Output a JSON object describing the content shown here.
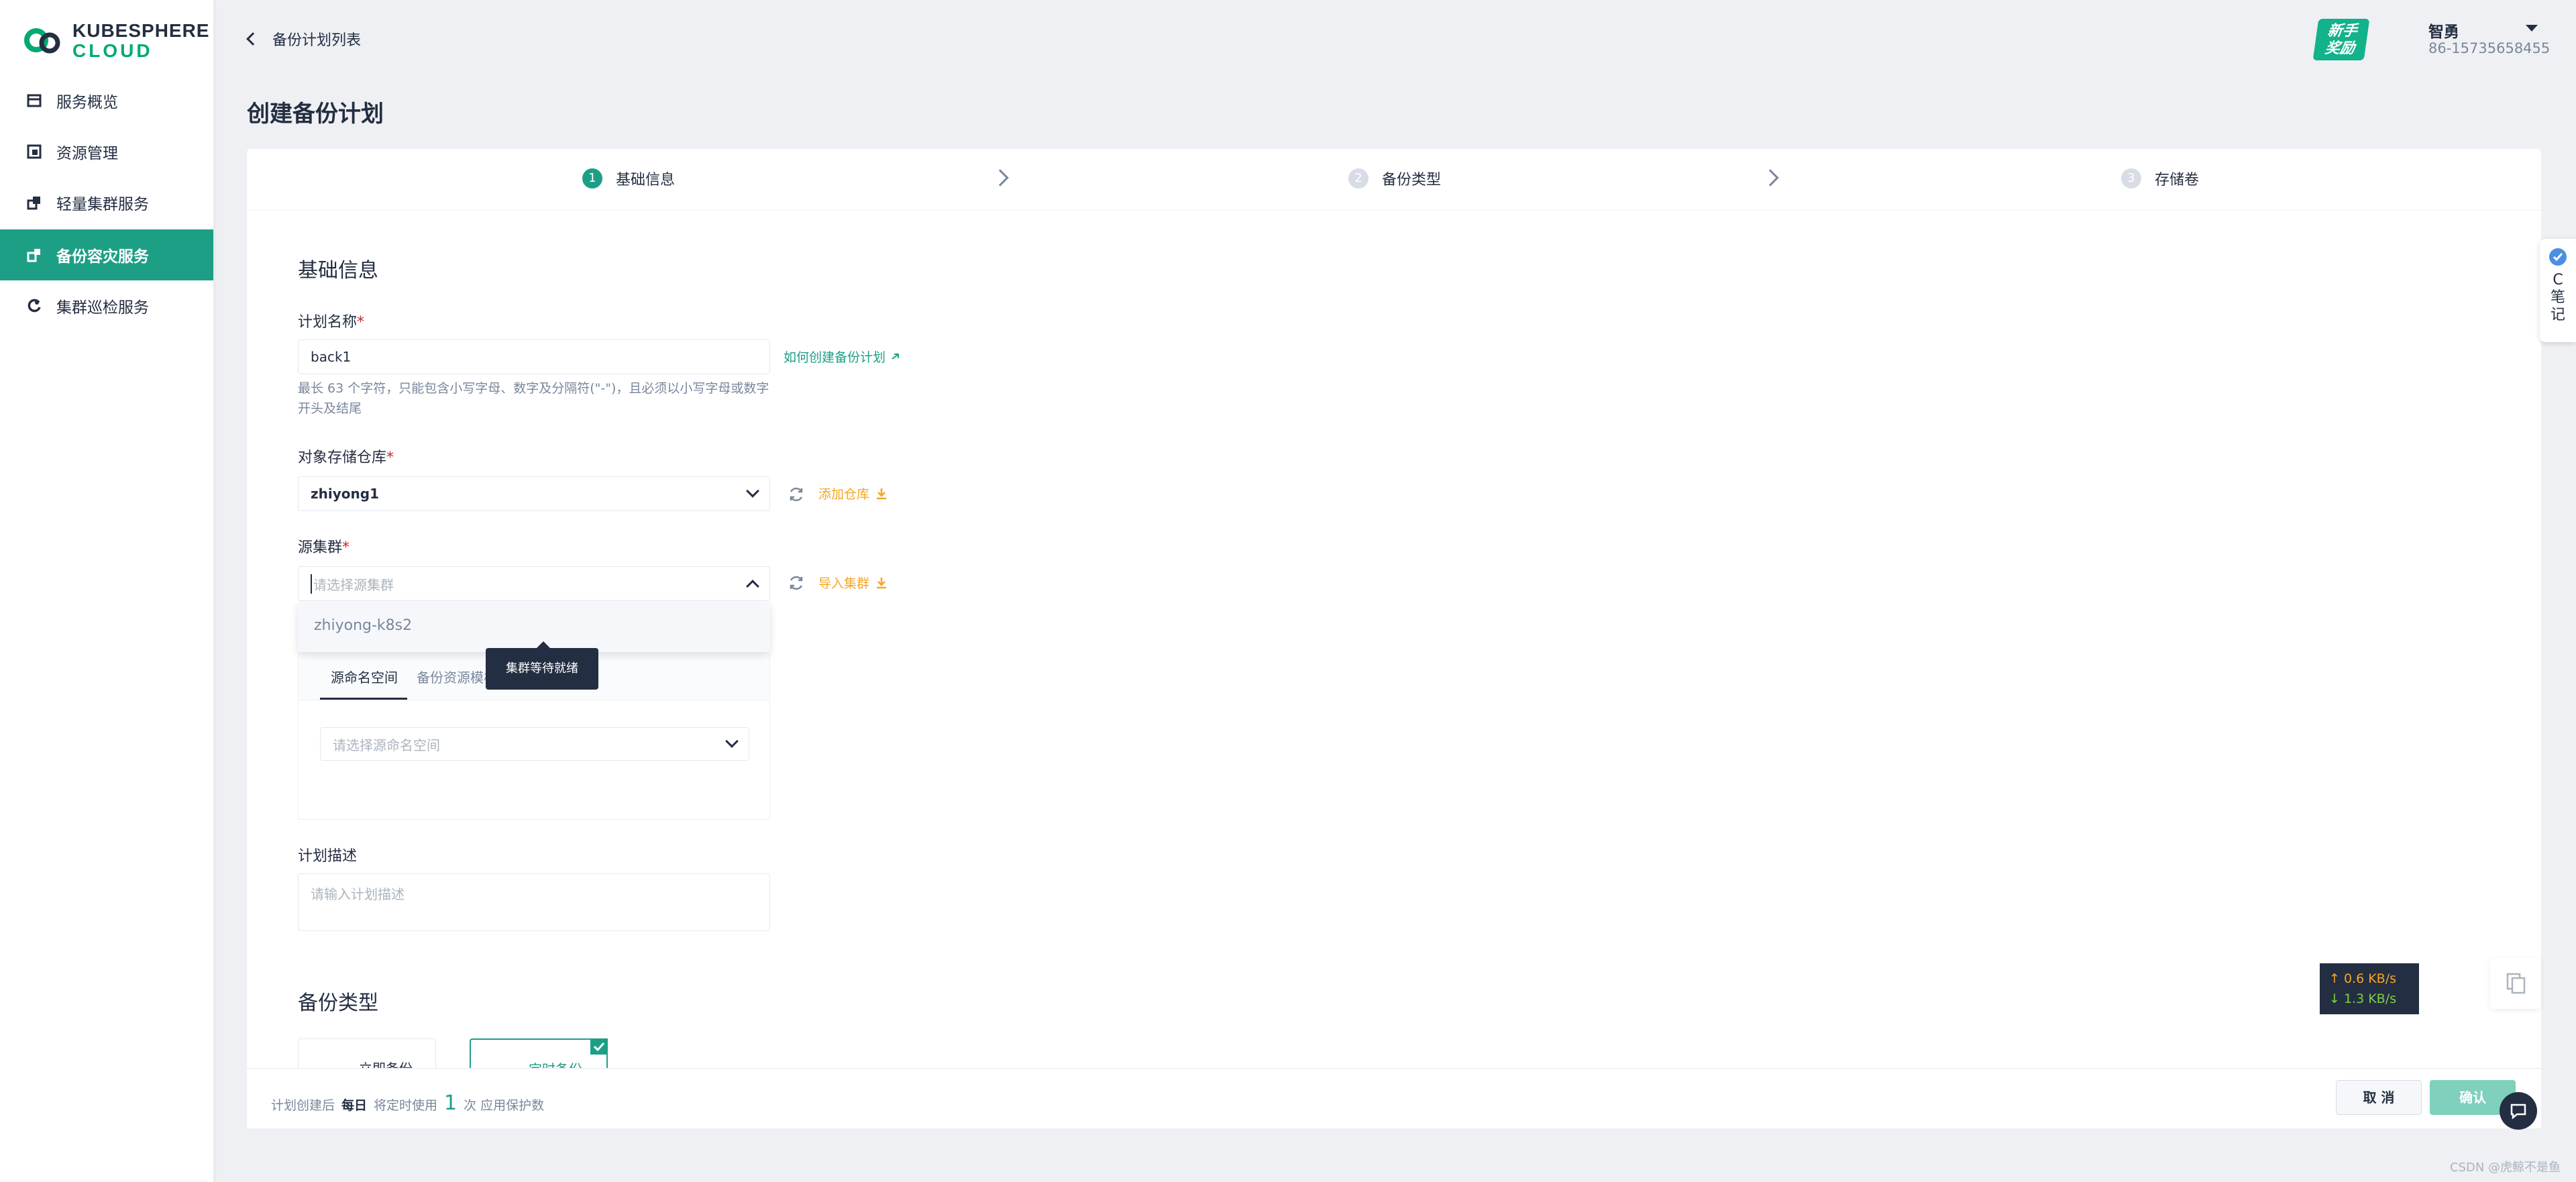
{
  "app": {
    "logo_line1": "KUBESPHERE",
    "logo_line2": "CLOUD"
  },
  "sidebar": {
    "items": [
      {
        "label": "服务概览",
        "icon": "overview-icon",
        "active": false
      },
      {
        "label": "资源管理",
        "icon": "resource-icon",
        "active": false
      },
      {
        "label": "轻量集群服务",
        "icon": "cluster-icon",
        "active": false
      },
      {
        "label": "备份容灾服务",
        "icon": "backup-icon",
        "active": true
      },
      {
        "label": "集群巡检服务",
        "icon": "inspection-icon",
        "active": false
      }
    ]
  },
  "header": {
    "back_label": "备份计划列表",
    "reward_line1": "新手",
    "reward_line2": "奖励",
    "user_name": "智勇",
    "user_phone": "86-15735658455"
  },
  "page": {
    "title": "创建备份计划"
  },
  "steps": [
    {
      "num": "1",
      "label": "基础信息"
    },
    {
      "num": "2",
      "label": "备份类型"
    },
    {
      "num": "3",
      "label": "存储卷"
    }
  ],
  "form": {
    "section_title": "基础信息",
    "plan_name": {
      "label": "计划名称",
      "required": "*",
      "value": "back1",
      "help": "最长 63 个字符，只能包含小写字母、数字及分隔符(\"-\")，且必须以小写字母或数字开头及结尾",
      "link": "如何创建备份计划"
    },
    "repo": {
      "label": "对象存储仓库",
      "required": "*",
      "value": "zhiyong1",
      "add_link": "添加仓库"
    },
    "source_cluster": {
      "label": "源集群",
      "required": "*",
      "placeholder": "请选择源集群",
      "import_link": "导入集群",
      "options": [
        "zhiyong-k8s2"
      ],
      "tooltip": "集群等待就绪"
    },
    "tabs": [
      {
        "label": "源命名空间"
      },
      {
        "label": "备份资源模板"
      }
    ],
    "namespace_placeholder": "请选择源命名空间",
    "description": {
      "label": "计划描述",
      "placeholder": "请输入计划描述"
    }
  },
  "backup_type": {
    "section_title": "备份类型",
    "options": [
      "立即备份",
      "定时备份"
    ]
  },
  "footer": {
    "text1": "计划创建后",
    "bold": "每日",
    "text2": "将定时使用",
    "count": "1",
    "text3": "次 应用保护数",
    "cancel": "取 消",
    "confirm": "确认"
  },
  "overlay": {
    "upload_speed": "↑ 0.6 KB/s",
    "download_speed": "↓ 1.3 KB/s",
    "note_line1": "C",
    "note_line2": "笔",
    "note_line3": "记",
    "watermark": "CSDN @虎鲸不是鱼"
  },
  "colors": {
    "accent": "#1d9f86",
    "warning": "#f5a623",
    "required": "#ca2621",
    "dark": "#242e42"
  }
}
